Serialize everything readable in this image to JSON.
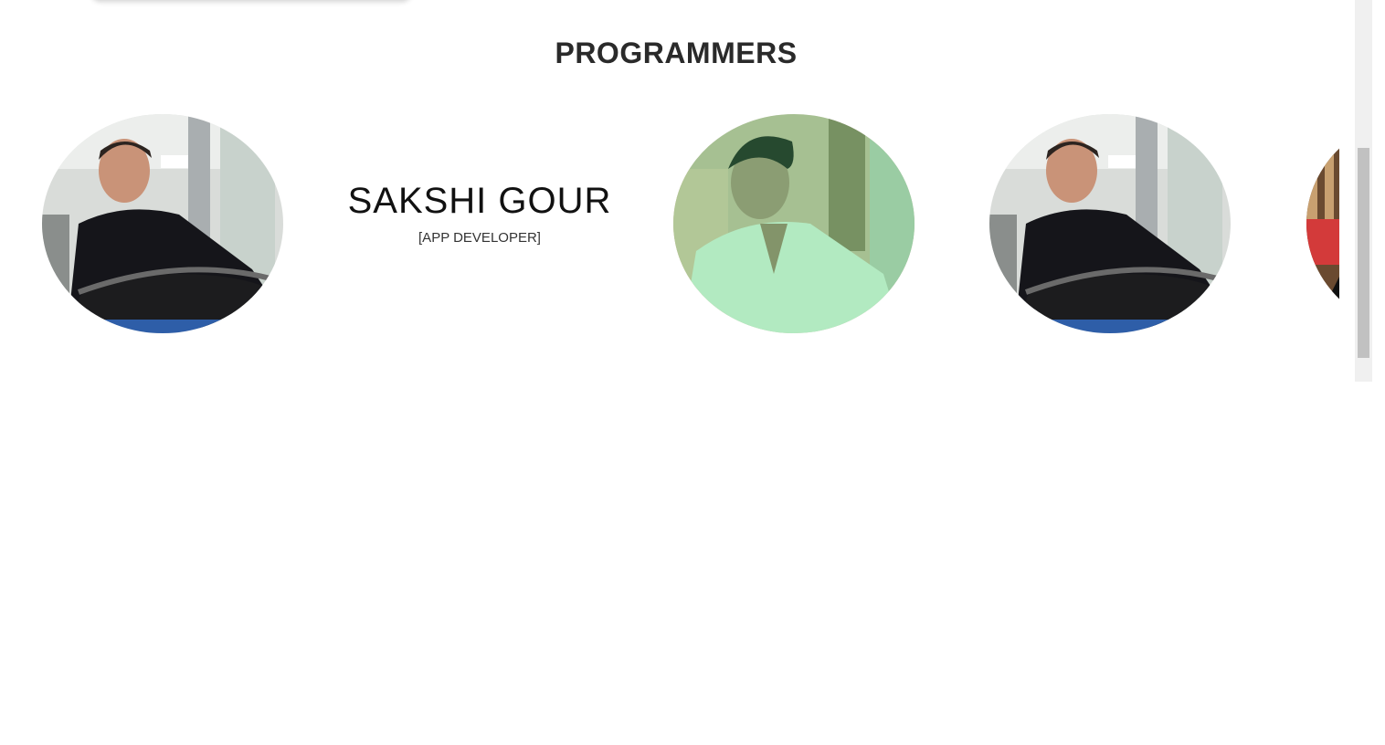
{
  "section": {
    "title": "PROGRAMMERS"
  },
  "featured": {
    "name": "SAKSHI GOUR",
    "role": "[APP DEVELOPER]"
  },
  "colors": {
    "background": "#ffffff",
    "title": "#2a2a2a",
    "scrollbar_track": "#f0f0f0",
    "scrollbar_thumb": "#c1c1c1"
  }
}
